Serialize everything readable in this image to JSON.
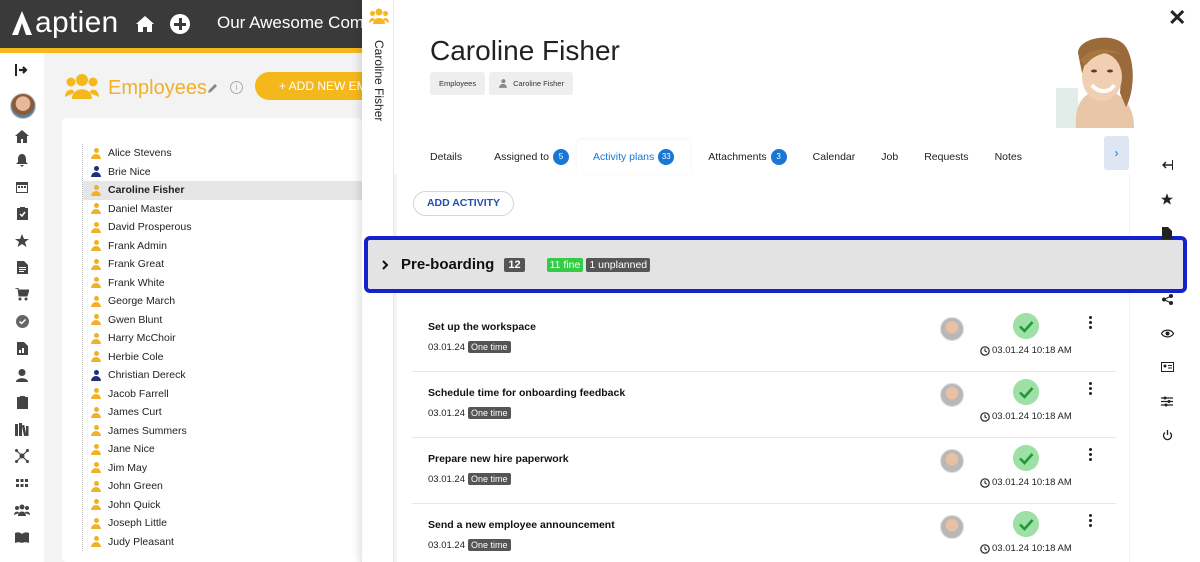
{
  "app": {
    "logo_text": "aptien",
    "company": "Our Awesome Company"
  },
  "employees_page": {
    "title": "Employees",
    "add_button": "+ ADD NEW EMPLOYEE",
    "list": [
      {
        "name": "Alice Stevens",
        "color": "yellow"
      },
      {
        "name": "Brie Nice",
        "color": "blue"
      },
      {
        "name": "Caroline Fisher",
        "color": "yellow",
        "selected": true
      },
      {
        "name": "Daniel Master",
        "color": "yellow"
      },
      {
        "name": "David Prosperous",
        "color": "yellow"
      },
      {
        "name": "Frank Admin",
        "color": "yellow"
      },
      {
        "name": "Frank Great",
        "color": "yellow"
      },
      {
        "name": "Frank White",
        "color": "yellow"
      },
      {
        "name": "George March",
        "color": "yellow"
      },
      {
        "name": "Gwen Blunt",
        "color": "yellow"
      },
      {
        "name": "Harry McChoir",
        "color": "yellow"
      },
      {
        "name": "Herbie Cole",
        "color": "yellow"
      },
      {
        "name": "Christian Dereck",
        "color": "blue"
      },
      {
        "name": "Jacob Farrell",
        "color": "yellow"
      },
      {
        "name": "James Curt",
        "color": "yellow"
      },
      {
        "name": "James Summers",
        "color": "yellow"
      },
      {
        "name": "Jane Nice",
        "color": "yellow"
      },
      {
        "name": "Jim May",
        "color": "yellow"
      },
      {
        "name": "John Green",
        "color": "yellow"
      },
      {
        "name": "John Quick",
        "color": "yellow"
      },
      {
        "name": "Joseph Little",
        "color": "yellow"
      },
      {
        "name": "Judy Pleasant",
        "color": "yellow"
      }
    ]
  },
  "panel": {
    "vertical_title": "Caroline Fisher",
    "name": "Caroline Fisher",
    "breadcrumbs": [
      "Employees",
      "Caroline Fisher"
    ],
    "tabs": [
      {
        "label": "Details"
      },
      {
        "label": "Assigned to",
        "badge": "5"
      },
      {
        "label": "Activity plans",
        "badge": "33",
        "active": true
      },
      {
        "label": "Attachments",
        "badge": "3"
      },
      {
        "label": "Calendar"
      },
      {
        "label": "Job"
      },
      {
        "label": "Requests"
      },
      {
        "label": "Notes"
      }
    ],
    "add_activity": "ADD ACTIVITY",
    "phase": {
      "title": "Pre-boarding",
      "count": "12",
      "fine": "11 fine",
      "unplanned": "1 unplanned"
    },
    "activities": [
      {
        "title": "Set up the workspace",
        "date": "03.01.24",
        "type": "One time",
        "done": "03.01.24 10:18 AM"
      },
      {
        "title": "Schedule time for onboarding feedback",
        "date": "03.01.24",
        "type": "One time",
        "done": "03.01.24 10:18 AM"
      },
      {
        "title": "Prepare new hire paperwork",
        "date": "03.01.24",
        "type": "One time",
        "done": "03.01.24 10:18 AM"
      },
      {
        "title": "Send a new employee announcement",
        "date": "03.01.24",
        "type": "One time",
        "done": "03.01.24 10:18 AM"
      }
    ]
  },
  "colors": {
    "accent": "#f5b81c",
    "topbar": "#3a3a3a",
    "link": "#1976d2",
    "highlight": "#1322c9",
    "success": "#33cc44"
  },
  "icons": {
    "left_nav": [
      "exit-icon",
      "avatar",
      "home-icon",
      "bell-icon",
      "calendar-icon",
      "clipboard-icon",
      "star-icon",
      "document-icon",
      "cart-icon",
      "check-circle-icon",
      "report-icon",
      "person-icon",
      "clipboard2-icon",
      "library-icon",
      "network-icon",
      "grid-icon",
      "team-icon",
      "book-icon"
    ],
    "right_nav": [
      "collapse-icon",
      "star-icon",
      "file-icon",
      "share-icon",
      "eye-icon",
      "id-card-icon",
      "sliders-icon",
      "power-icon"
    ]
  }
}
